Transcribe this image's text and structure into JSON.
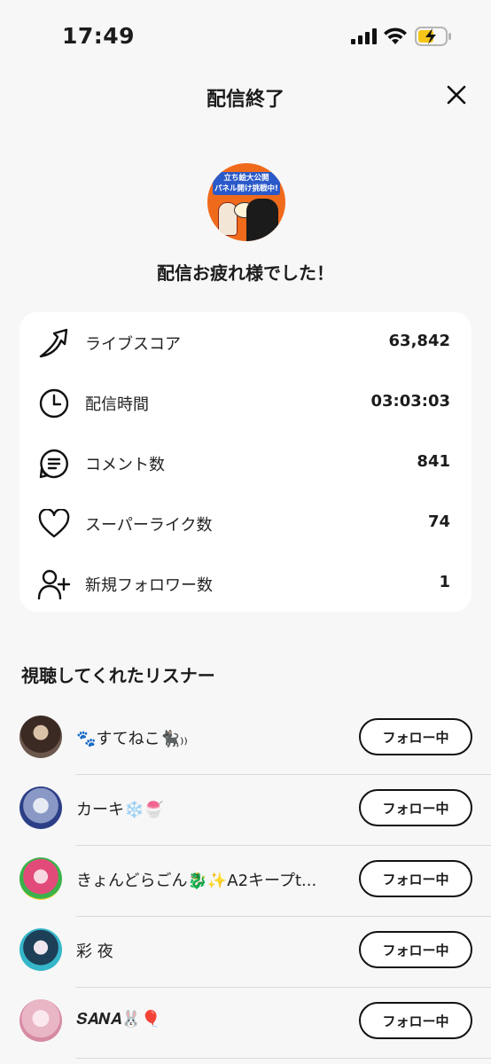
{
  "status_bar": {
    "time": "17:49"
  },
  "header": {
    "title": "配信終了"
  },
  "stream": {
    "thumb_line1": "立ち絵大公開",
    "thumb_line2": "パネル開け挑戦中!",
    "thanks_message": "配信お疲れ様でした！"
  },
  "stats": [
    {
      "icon": "live-score-icon",
      "label": "ライブスコア",
      "value": "63,842"
    },
    {
      "icon": "clock-icon",
      "label": "配信時間",
      "value": "03:03:03"
    },
    {
      "icon": "comment-icon",
      "label": "コメント数",
      "value": "841"
    },
    {
      "icon": "heart-icon",
      "label": "スーパーライク数",
      "value": "74"
    },
    {
      "icon": "add-user-icon",
      "label": "新規フォロワー数",
      "value": "1"
    }
  ],
  "listeners_section": {
    "title": "視聴してくれたリスナー"
  },
  "listeners": [
    {
      "name": "🐾すてねこ🐈‍⬛₎₎",
      "button": "フォロー中"
    },
    {
      "name": "カーキ❄️🍧",
      "button": "フォロー中"
    },
    {
      "name": "きょんどらごん🐉✨A2キープt...",
      "button": "フォロー中"
    },
    {
      "name": "彩 夜",
      "button": "フォロー中"
    },
    {
      "name": "𝑺𝑨𝑵𝑨🐰🎈",
      "button": "フォロー中"
    }
  ]
}
